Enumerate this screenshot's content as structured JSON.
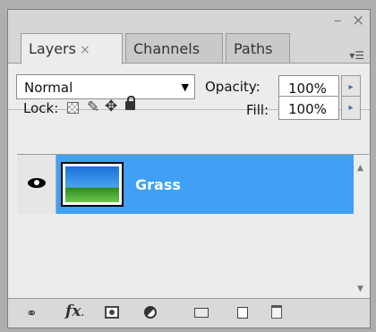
{
  "window": {
    "minimize_glyph": "–",
    "close_glyph": "×"
  },
  "tabs": [
    {
      "label": "Layers",
      "close": "×",
      "active": true
    },
    {
      "label": "Channels",
      "active": false
    },
    {
      "label": "Paths",
      "active": false
    }
  ],
  "panel_menu_glyph": "▾☰",
  "blend": {
    "value": "Normal",
    "arrow": "▼"
  },
  "opacity": {
    "label": "Opacity:",
    "value": "100%",
    "arrow": "▸"
  },
  "lock": {
    "label": "Lock:",
    "icons": [
      "lock-transparent-icon",
      "lock-image-brush-icon",
      "lock-position-move-icon",
      "lock-all-padlock-icon"
    ]
  },
  "fill": {
    "label": "Fill:",
    "value": "100%",
    "arrow": "▸"
  },
  "layers": [
    {
      "name": "Grass",
      "visible": true,
      "selected": true
    }
  ],
  "scrollbar": {
    "up": "▲",
    "down": "▼"
  },
  "bottom_icons": [
    "link-layers-icon",
    "fx-effects-icon",
    "layer-mask-icon",
    "adjustment-layer-icon",
    "new-group-folder-icon",
    "new-layer-icon",
    "trash-icon"
  ],
  "bottom_labels": {
    "fx": "fx"
  },
  "colors": {
    "selection": "#3fa0f5",
    "panel_bg": "#ececec",
    "frame_bg": "#aeaeae"
  }
}
